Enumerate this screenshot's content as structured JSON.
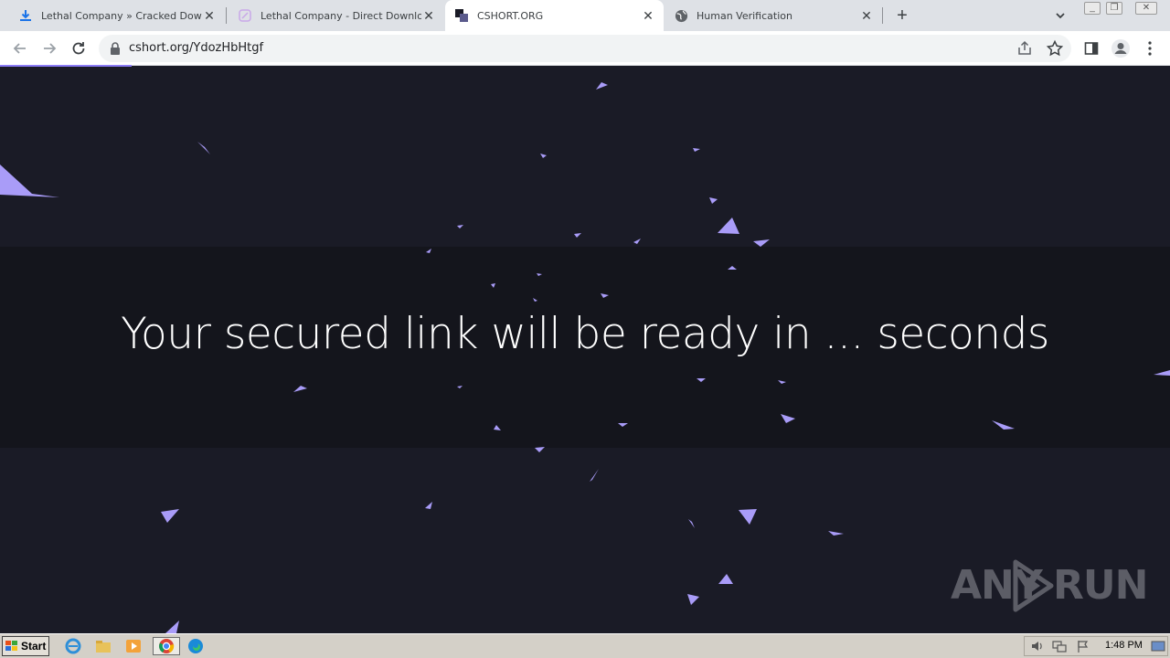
{
  "browser": {
    "tabs": [
      {
        "title": "Lethal Company » Cracked Download",
        "icon": "download-icon",
        "active": false
      },
      {
        "title": "Lethal Company - Direct Download (F",
        "icon": "pen-icon",
        "active": false
      },
      {
        "title": "CSHORT.ORG",
        "icon": "cshort-logo-icon",
        "active": true
      },
      {
        "title": "Human Verification",
        "icon": "globe-icon",
        "active": false
      }
    ],
    "url": "cshort.org/YdozHbHtgf"
  },
  "page": {
    "headline": "Your secured link will be ready in ... seconds",
    "accent_color": "#a99cf8",
    "background_color": "#1a1b26"
  },
  "watermark": {
    "text_left": "ANY",
    "text_right": "RUN"
  },
  "taskbar": {
    "start_label": "Start",
    "clock": "1:48 PM"
  }
}
